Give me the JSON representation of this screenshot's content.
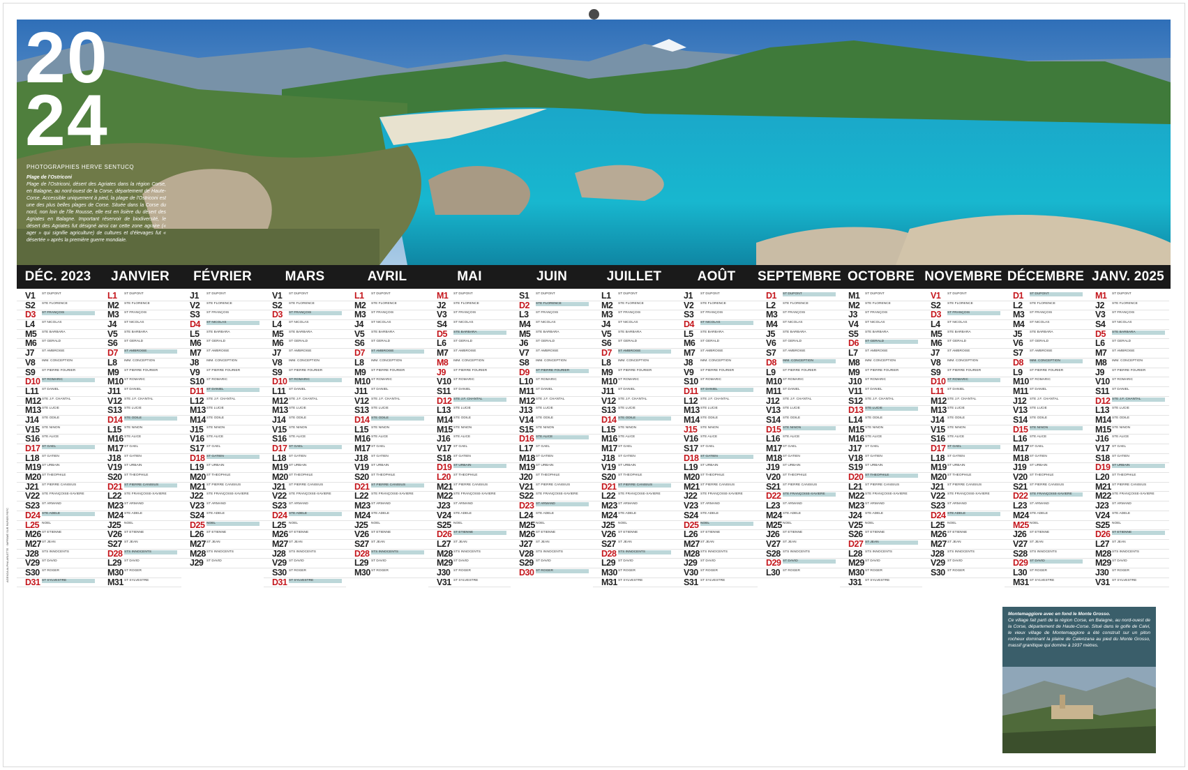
{
  "calendar": {
    "year_top": "20",
    "year_bottom": "24",
    "photo_credit": "PHOTOGRAPHIES HERVE SENTUCQ",
    "caption_title": "Plage de l'Ostriconi",
    "caption_text": "Plage de l'Ostriconi, désert des Agriates dans la région Corse, en Balagne, au nord-ouest de la Corse, département de Haute-Corse. Accessible uniquement à pied, la plage de l'Ostriconi est une des plus belles plages de Corse. Située dans la Corse du nord, non loin de l'île Rousse, elle est en lisière du désert des Agriates en Balagne. Important réservoir de biodiversité, le désert des Agriates fut désigné ainsi car cette zone agraire (« ager » qui signifie agriculture) de cultures et d'élevages fut « désertée » après la première guerre mondiale.",
    "inset_title": "Montemaggiore avec en fond le Monte Grosso.",
    "inset_text": "Ce village fait parti de la région Corse, en Balagne, au nord-ouest de la Corse, département de Haute-Corse. Situé dans le golfe de Calvi, le vieux village de Montemaggiore a été construit sur un piton rocheux dominant la plaine de Calenzana au pied du Monte Grosso, massif granitique qui domine à 1937 mètres.",
    "side_legal": "AGENDA ALPHA ARLETTE · IMPRIMÉ SUR PAPIER PEFC"
  },
  "months": [
    {
      "name": "DÉC. 2023",
      "start": 5,
      "days": 31
    },
    {
      "name": "JANVIER",
      "start": 1,
      "days": 31
    },
    {
      "name": "FÉVRIER",
      "start": 4,
      "days": 29
    },
    {
      "name": "MARS",
      "start": 5,
      "days": 31
    },
    {
      "name": "AVRIL",
      "start": 1,
      "days": 30
    },
    {
      "name": "MAI",
      "start": 3,
      "days": 31
    },
    {
      "name": "JUIN",
      "start": 6,
      "days": 30
    },
    {
      "name": "JUILLET",
      "start": 1,
      "days": 31
    },
    {
      "name": "AOÛT",
      "start": 4,
      "days": 31
    },
    {
      "name": "SEPTEMBRE",
      "start": 0,
      "days": 30
    },
    {
      "name": "OCTOBRE",
      "start": 2,
      "days": 31
    },
    {
      "name": "NOVEMBRE",
      "start": 5,
      "days": 30
    },
    {
      "name": "DÉCEMBRE",
      "start": 0,
      "days": 31
    },
    {
      "name": "JANV. 2025",
      "start": 3,
      "days": 31
    }
  ],
  "weekday_letters": [
    "D",
    "L",
    "M",
    "M",
    "J",
    "V",
    "S"
  ],
  "saints": [
    "ST DUPONT",
    "STE FLORENCE",
    "ST FRANÇOIS",
    "ST NICOLAS",
    "STE BARBARA",
    "ST GÉRALD",
    "ST AMBROISE",
    "IMM. CONCEPTION",
    "ST PIERRE FOURIER",
    "ST ROMARIC",
    "ST DANIEL",
    "STE J.F. CHANTAL",
    "STE LUCIE",
    "STE ODILE",
    "STE NINON",
    "STE ALICE",
    "ST GAËL",
    "ST GATIEN",
    "ST URBAIN",
    "ST THÉOPHILE",
    "ST PIERRE CANISIUS",
    "STE FRANÇOISE-XAVIÈRE",
    "ST ARMAND",
    "STE ADÈLE",
    "NOËL",
    "ST ÉTIENNE",
    "ST JEAN",
    "STS INNOCENTS",
    "ST DAVID",
    "ST ROGER",
    "ST SYLVESTRE"
  ],
  "highlights": [
    0,
    6,
    13,
    20,
    27
  ],
  "holidays": {
    "JANVIER": [
      1
    ],
    "AVRIL": [
      1
    ],
    "MAI": [
      1,
      8,
      9,
      20
    ],
    "JUILLET": [
      14
    ],
    "AOÛT": [
      15
    ],
    "NOVEMBRE": [
      1,
      11
    ],
    "DÉCEMBRE": [
      25
    ],
    "DÉC. 2023": [
      25
    ],
    "JANV. 2025": [
      1
    ]
  },
  "colors": {
    "accent": "#c4161c",
    "highlight": "#bcd7d9",
    "header": "#1a1a1a",
    "inset": "#3a5e6a"
  }
}
